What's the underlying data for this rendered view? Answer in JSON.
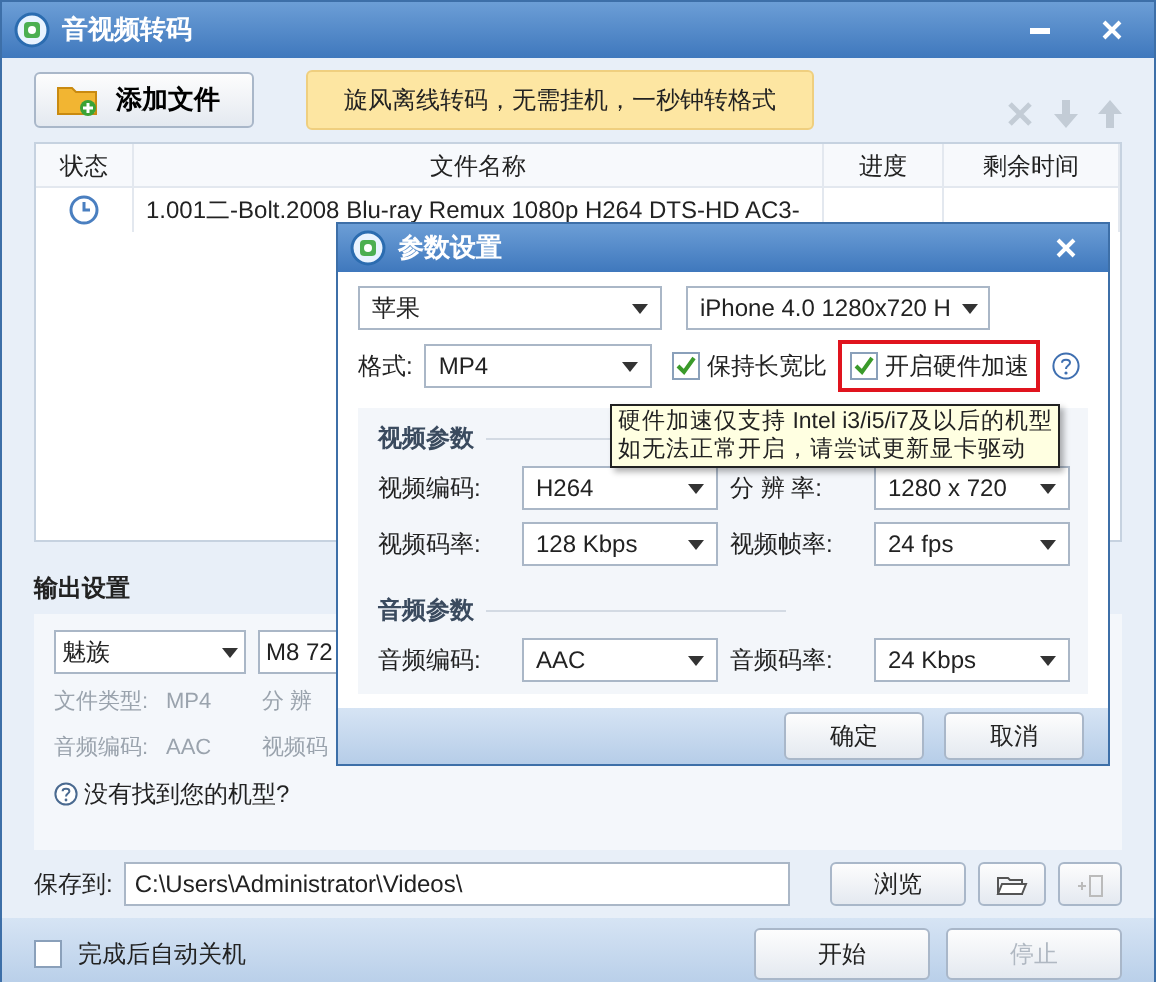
{
  "window": {
    "title": "音视频转码"
  },
  "toolbar": {
    "add_button": "添加文件",
    "banner": "旋风离线转码，无需挂机，一秒钟转格式"
  },
  "table": {
    "columns": [
      "状态",
      "文件名称",
      "进度",
      "剩余时间"
    ],
    "rows": [
      {
        "file": "1.001二-Bolt.2008 Blu-ray Remux 1080p H264 DTS-HD AC3-"
      }
    ]
  },
  "output": {
    "title": "输出设置",
    "brand": "魅族",
    "model": "M8 72",
    "info": [
      {
        "label": "文件类型:",
        "value": "MP4"
      },
      {
        "label": "分 辨"
      },
      {
        "label": "音频编码:",
        "value": "AAC"
      },
      {
        "label": "视频码"
      }
    ],
    "help": "没有找到您的机型?"
  },
  "save": {
    "label": "保存到:",
    "path": "C:\\Users\\Administrator\\Videos\\",
    "browse": "浏览"
  },
  "footer": {
    "shutdown": {
      "label": "完成后自动关机",
      "checked": false
    },
    "buttons": [
      {
        "label": "开始",
        "disabled": false
      },
      {
        "label": "停止",
        "disabled": true
      }
    ]
  },
  "dialog": {
    "title": "参数设置",
    "brand": "苹果",
    "model": "iPhone 4.0 1280x720 H",
    "format": {
      "label": "格式:",
      "value": "MP4"
    },
    "options": [
      {
        "label": "保持长宽比",
        "checked": true,
        "highlighted": false
      },
      {
        "label": "开启硬件加速",
        "checked": true,
        "highlighted": true
      }
    ],
    "tooltip": [
      "硬件加速仅支持 Intel i3/i5/i7及以后的机型",
      "如无法正常开启，请尝试更新显卡驱动"
    ],
    "groups": [
      {
        "title": "视频参数",
        "fields": [
          {
            "label": "视频编码:",
            "value": "H264"
          },
          {
            "label": "分 辨 率:",
            "value": "1280 x 720"
          },
          {
            "label": "视频码率:",
            "value": "128 Kbps"
          },
          {
            "label": "视频帧率:",
            "value": "24 fps"
          }
        ]
      },
      {
        "title": "音频参数",
        "fields": [
          {
            "label": "音频编码:",
            "value": "AAC"
          },
          {
            "label": "音频码率:",
            "value": "24 Kbps"
          }
        ]
      }
    ],
    "buttons": [
      "确定",
      "取消"
    ]
  }
}
